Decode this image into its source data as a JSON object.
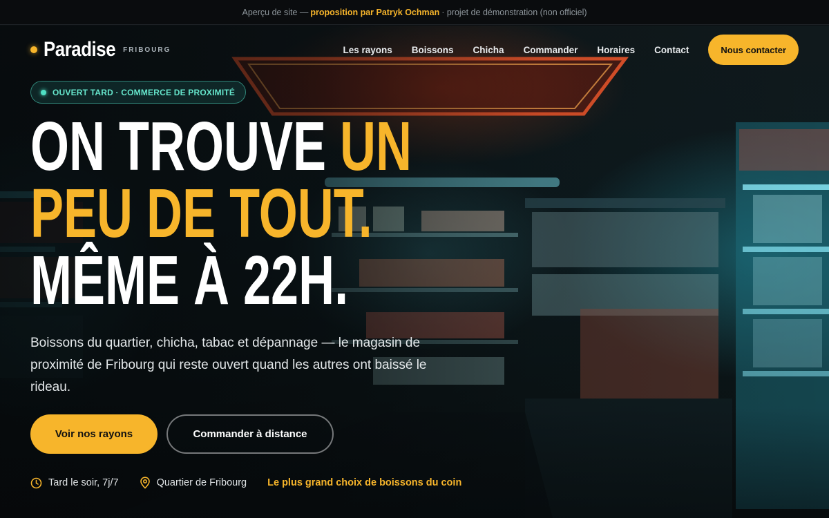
{
  "topbar": {
    "prefix": "Aperçu de site —",
    "author": "proposition par Patryk Ochman",
    "suffix": "· projet de démonstration (non officiel)"
  },
  "brand": {
    "name": "Paradise",
    "city": "FRIBOURG"
  },
  "nav": {
    "links": [
      "Les rayons",
      "Boissons",
      "Chicha",
      "Commander",
      "Horaires",
      "Contact"
    ],
    "cta": "Nous contacter"
  },
  "badge": {
    "text": "OUVERT TARD · COMMERCE DE PROXIMITÉ",
    "icon": "status-dot"
  },
  "headline": {
    "line1_plain": "ON TROUVE ",
    "line1_accent": "UN",
    "line2_accent": "PEU DE TOUT.",
    "line3": "MÊME À 22H."
  },
  "lead": "Boissons du quartier, chicha, tabac et dépannage — le magasin de proximité de Fribourg qui reste ouvert quand les autres ont baissé le rideau.",
  "buttons": {
    "primary": "Voir nos rayons",
    "secondary": "Commander à distance"
  },
  "info": {
    "hours": "Tard le soir, 7j/7",
    "hours_icon": "clock-icon",
    "location": "Quartier de Fribourg",
    "location_icon": "map-pin-icon",
    "highlight": "Le plus grand choix de boissons du coin"
  },
  "colors": {
    "accent": "#f7b52b",
    "badge": "#66e6cc",
    "background": "#0b0f12"
  }
}
